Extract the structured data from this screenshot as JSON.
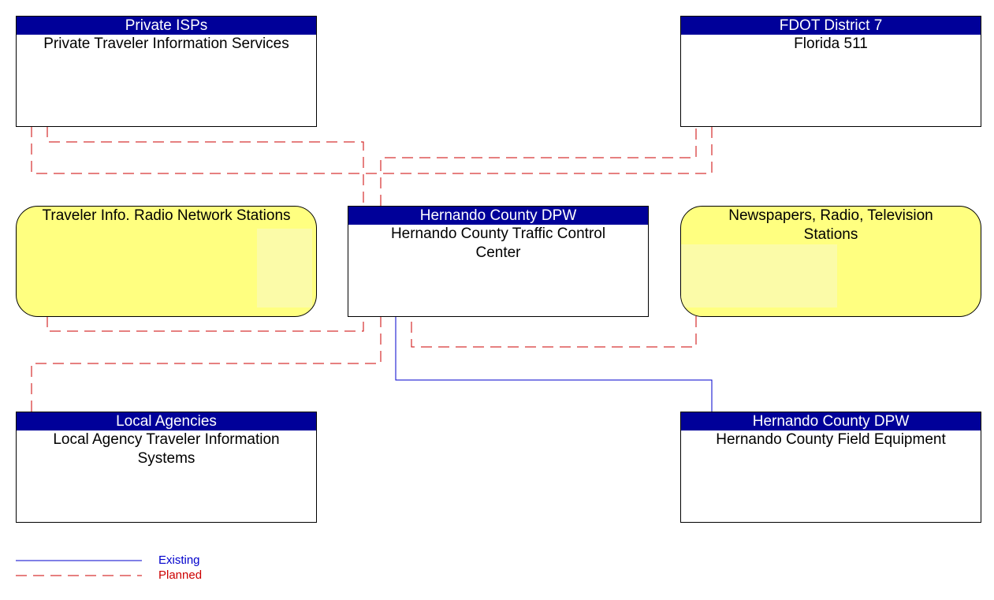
{
  "colors": {
    "header": "#000099",
    "existing": "#0000cc",
    "planned": "#cc0000",
    "yellow": "#ffff80"
  },
  "nodes": {
    "private_isps": {
      "header": "Private ISPs",
      "title": "Private Traveler Information Services"
    },
    "fdot": {
      "header": "FDOT District 7",
      "title": "Florida 511"
    },
    "radio_network": {
      "title": "Traveler Info. Radio Network Stations"
    },
    "tcc": {
      "header": "Hernando County DPW",
      "title": "Hernando County Traffic Control Center"
    },
    "media": {
      "title": "Newspapers, Radio, Television Stations"
    },
    "local": {
      "header": "Local Agencies",
      "title": "Local Agency Traveler Information Systems"
    },
    "field": {
      "header": "Hernando County DPW",
      "title": "Hernando County Field Equipment"
    }
  },
  "legend": {
    "existing": "Existing",
    "planned": "Planned"
  }
}
